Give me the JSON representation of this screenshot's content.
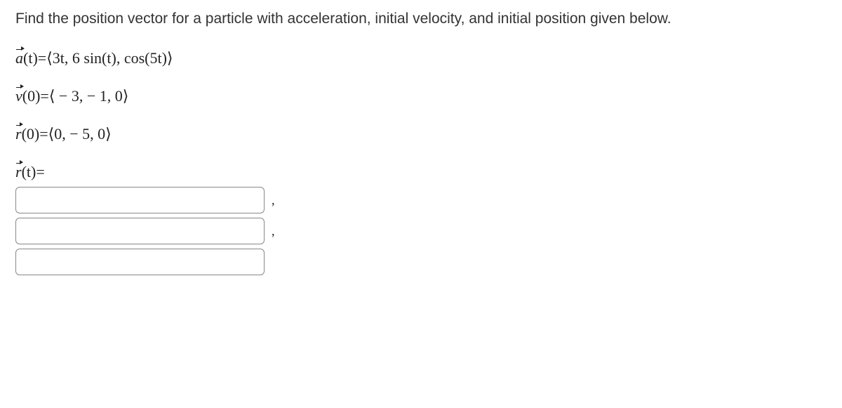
{
  "problem": {
    "text": "Find the position vector for a particle with acceleration, initial velocity, and initial position given below."
  },
  "equations": {
    "acc": {
      "lhs_var": "a",
      "lhs_arg": "(t)",
      "eq": " = ",
      "rhs": "⟨3t, 6 sin(t), cos(5t)⟩"
    },
    "vel": {
      "lhs_var": "v",
      "lhs_arg": "(0)",
      "eq": " = ",
      "rhs": "⟨ − 3,  − 1, 0⟩"
    },
    "pos": {
      "lhs_var": "r",
      "lhs_arg": "(0)",
      "eq": " = ",
      "rhs": "⟨0,  − 5, 0⟩"
    },
    "result": {
      "lhs_var": "r",
      "lhs_arg": "(t)",
      "eq": " = "
    }
  },
  "inputs": {
    "x": "",
    "y": "",
    "z": ""
  },
  "sep": ","
}
